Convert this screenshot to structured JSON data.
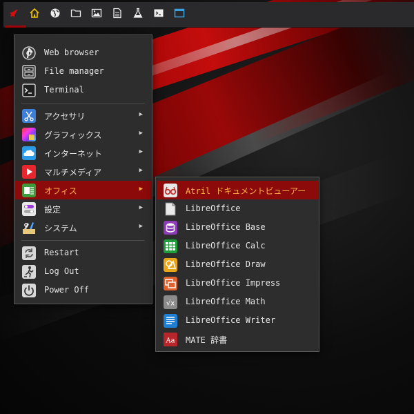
{
  "panel": {
    "buttons": [
      {
        "name": "menu",
        "icon": "rocket-icon"
      },
      {
        "name": "home",
        "icon": "home-icon"
      },
      {
        "name": "web",
        "icon": "globe-icon"
      },
      {
        "name": "files",
        "icon": "folder-icon"
      },
      {
        "name": "images",
        "icon": "image-icon"
      },
      {
        "name": "documents",
        "icon": "document-icon"
      },
      {
        "name": "science",
        "icon": "flask-icon"
      },
      {
        "name": "terminal",
        "icon": "terminal-icon"
      },
      {
        "name": "windows",
        "icon": "window-icon"
      }
    ]
  },
  "main_menu": {
    "places": [
      {
        "label": "Web browser",
        "icon": "web-browser-icon"
      },
      {
        "label": "File manager",
        "icon": "file-manager-icon"
      },
      {
        "label": "Terminal",
        "icon": "terminal-app-icon"
      }
    ],
    "categories": [
      {
        "label": "アクセサリ",
        "icon": "accessories-icon"
      },
      {
        "label": "グラフィックス",
        "icon": "graphics-icon"
      },
      {
        "label": "インターネット",
        "icon": "internet-icon"
      },
      {
        "label": "マルチメディア",
        "icon": "multimedia-icon"
      },
      {
        "label": "オフィス",
        "icon": "office-icon",
        "active": true
      },
      {
        "label": "設定",
        "icon": "settings-icon"
      },
      {
        "label": "システム",
        "icon": "system-icon"
      }
    ],
    "session": [
      {
        "label": "Restart",
        "icon": "restart-icon"
      },
      {
        "label": "Log Out",
        "icon": "logout-icon"
      },
      {
        "label": "Power Off",
        "icon": "power-icon"
      }
    ],
    "arrow": "▶"
  },
  "office_menu": {
    "items": [
      {
        "label": "Atril ドキュメントビューアー",
        "icon": "atril-icon",
        "active": true
      },
      {
        "label": "LibreOffice",
        "icon": "libreoffice-icon"
      },
      {
        "label": "LibreOffice Base",
        "icon": "libreoffice-base-icon"
      },
      {
        "label": "LibreOffice Calc",
        "icon": "libreoffice-calc-icon"
      },
      {
        "label": "LibreOffice Draw",
        "icon": "libreoffice-draw-icon"
      },
      {
        "label": "LibreOffice Impress",
        "icon": "libreoffice-impress-icon"
      },
      {
        "label": "LibreOffice Math",
        "icon": "libreoffice-math-icon"
      },
      {
        "label": "LibreOffice Writer",
        "icon": "libreoffice-writer-icon"
      },
      {
        "label": "MATE 辞書",
        "icon": "dictionary-icon"
      }
    ],
    "math_glyph": "√x",
    "dict_glyph": "Aa"
  },
  "colors": {
    "highlight": "#8c0a0a",
    "highlight_text": "#ffb347",
    "menu_bg": "#2d2d2d",
    "panel_bg": "#2a2a2c"
  }
}
